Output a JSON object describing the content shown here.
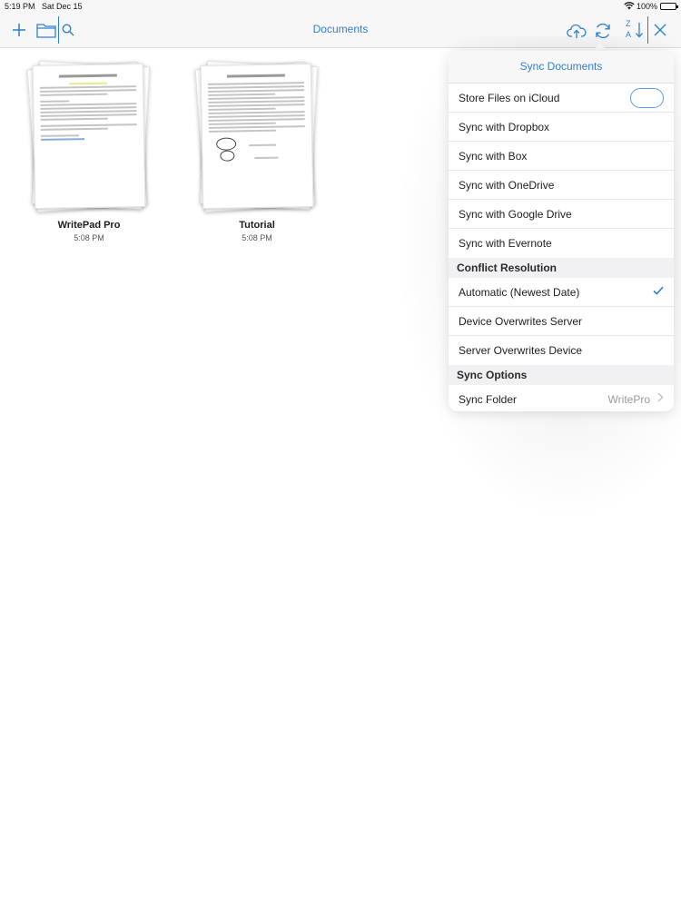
{
  "status_bar": {
    "time": "5:19 PM",
    "date": "Sat Dec 15",
    "battery": "100%",
    "battery_level": 1.0
  },
  "nav": {
    "title": "Documents",
    "left_icons": [
      "plus-icon",
      "folder-icon",
      "search-icon"
    ],
    "right_icons": [
      "cloud-upload-icon",
      "sync-icon",
      "sort-az-icon",
      "close-icon"
    ],
    "sort_top": "Z",
    "sort_bottom": "A"
  },
  "documents": [
    {
      "name": "WritePad Pro",
      "time": "5:08 PM"
    },
    {
      "name": "Tutorial",
      "time": "5:08 PM"
    }
  ],
  "popover": {
    "title": "Sync Documents",
    "rows": [
      {
        "label": "Store Files on iCloud",
        "toggle": false
      },
      {
        "label": "Sync with Dropbox"
      },
      {
        "label": "Sync with Box"
      },
      {
        "label": "Sync with OneDrive"
      },
      {
        "label": "Sync with Google Drive"
      },
      {
        "label": "Sync with Evernote"
      }
    ],
    "conflict_section": "Conflict Resolution",
    "conflict_rows": [
      {
        "label": "Automatic (Newest Date)",
        "checked": true
      },
      {
        "label": "Device Overwrites Server",
        "checked": false
      },
      {
        "label": "Server Overwrites Device",
        "checked": false
      }
    ],
    "options_section": "Sync Options",
    "sync_folder": {
      "label": "Sync Folder",
      "value": "WritePro"
    }
  },
  "colors": {
    "accent": "#2f7fd0",
    "bar_background": "#f7f7f7",
    "section_background": "#f1f1f3"
  }
}
